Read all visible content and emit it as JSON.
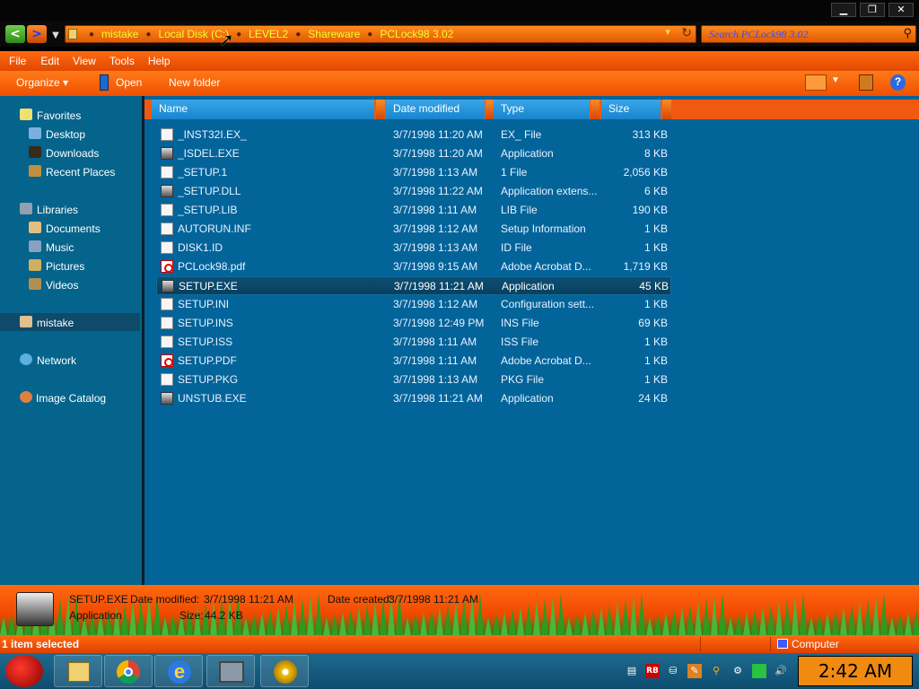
{
  "window": {
    "minimize": "▁",
    "restore": "❐",
    "close": "✕"
  },
  "address": {
    "back_icon": "arrow-left-icon",
    "forward_icon": "arrow-right-icon",
    "breadcrumbs": [
      "mistake",
      "Local Disk (C:)",
      "LEVEL2",
      "Shareware",
      "PCLock98 3.02"
    ]
  },
  "search": {
    "placeholder": "Search PCLock98 3.02"
  },
  "menu": [
    "File",
    "Edit",
    "View",
    "Tools",
    "Help"
  ],
  "toolbar": {
    "organize": "Organize",
    "open": "Open",
    "new_folder": "New folder"
  },
  "nav": {
    "favorites": "Favorites",
    "desktop": "Desktop",
    "downloads": "Downloads",
    "recent_places": "Recent Places",
    "libraries": "Libraries",
    "documents": "Documents",
    "music": "Music",
    "pictures": "Pictures",
    "videos": "Videos",
    "user": "mistake",
    "network": "Network",
    "image_catalog": "Image Catalog"
  },
  "columns": {
    "name": "Name",
    "date": "Date modified",
    "type": "Type",
    "size": "Size"
  },
  "files": [
    {
      "name": "_INST32I.EX_",
      "date": "3/7/1998 11:20 AM",
      "type": "EX_ File",
      "size": "313 KB",
      "icon": "doc"
    },
    {
      "name": "_ISDEL.EXE",
      "date": "3/7/1998 11:20 AM",
      "type": "Application",
      "size": "8 KB",
      "icon": "app"
    },
    {
      "name": "_SETUP.1",
      "date": "3/7/1998 1:13 AM",
      "type": "1 File",
      "size": "2,056 KB",
      "icon": "doc"
    },
    {
      "name": "_SETUP.DLL",
      "date": "3/7/1998 11:22 AM",
      "type": "Application extens...",
      "size": "6 KB",
      "icon": "app"
    },
    {
      "name": "_SETUP.LIB",
      "date": "3/7/1998 1:11 AM",
      "type": "LIB File",
      "size": "190 KB",
      "icon": "doc"
    },
    {
      "name": "AUTORUN.INF",
      "date": "3/7/1998 1:12 AM",
      "type": "Setup Information",
      "size": "1 KB",
      "icon": "doc"
    },
    {
      "name": "DISK1.ID",
      "date": "3/7/1998 1:13 AM",
      "type": "ID File",
      "size": "1 KB",
      "icon": "doc"
    },
    {
      "name": "PCLock98.pdf",
      "date": "3/7/1998 9:15 AM",
      "type": "Adobe Acrobat D...",
      "size": "1,719 KB",
      "icon": "pdf"
    },
    {
      "name": "SETUP.EXE",
      "date": "3/7/1998 11:21 AM",
      "type": "Application",
      "size": "45 KB",
      "icon": "app",
      "selected": true
    },
    {
      "name": "SETUP.INI",
      "date": "3/7/1998 1:12 AM",
      "type": "Configuration sett...",
      "size": "1 KB",
      "icon": "doc"
    },
    {
      "name": "SETUP.INS",
      "date": "3/7/1998 12:49 PM",
      "type": "INS File",
      "size": "69 KB",
      "icon": "doc"
    },
    {
      "name": "SETUP.ISS",
      "date": "3/7/1998 1:11 AM",
      "type": "ISS File",
      "size": "1 KB",
      "icon": "doc"
    },
    {
      "name": "SETUP.PDF",
      "date": "3/7/1998 1:11 AM",
      "type": "Adobe Acrobat D...",
      "size": "1 KB",
      "icon": "pdf"
    },
    {
      "name": "SETUP.PKG",
      "date": "3/7/1998 1:13 AM",
      "type": "PKG File",
      "size": "1 KB",
      "icon": "doc"
    },
    {
      "name": "UNSTUB.EXE",
      "date": "3/7/1998 11:21 AM",
      "type": "Application",
      "size": "24 KB",
      "icon": "app"
    }
  ],
  "details": {
    "filename": "SETUP.EXE",
    "date_modified_label": "Date modified:",
    "date_modified": "3/7/1998 11:21 AM",
    "date_created_label": "Date created:",
    "date_created": "3/7/1998 11:21 AM",
    "type": "Application",
    "size_label": "Size:",
    "size": "44.2 KB"
  },
  "status": {
    "selection": "1 item selected",
    "location": "Computer"
  },
  "taskbar": {
    "clock": "2:42 AM",
    "tray_rb": "RB"
  }
}
